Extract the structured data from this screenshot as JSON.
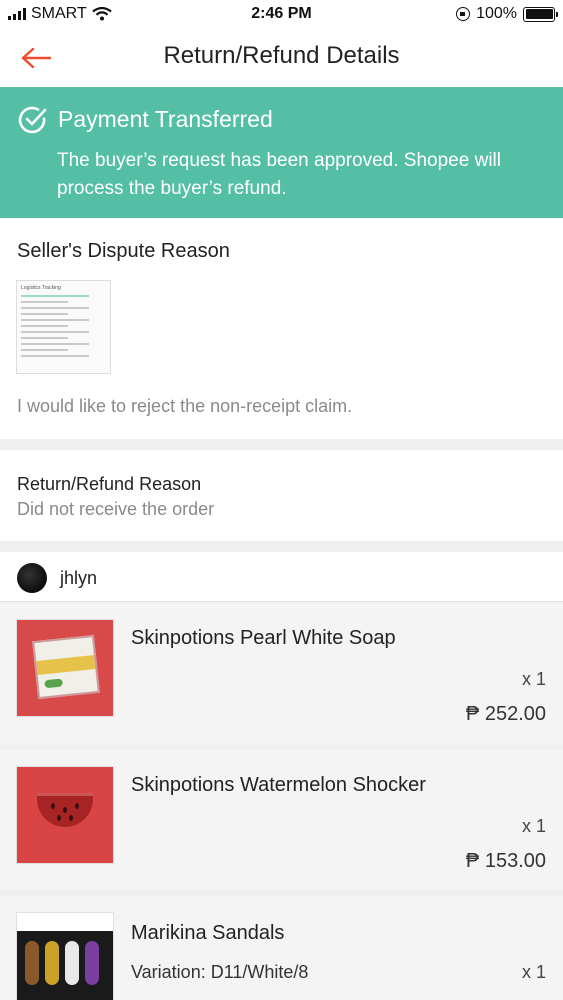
{
  "status_bar": {
    "carrier": "SMART",
    "time": "2:46 PM",
    "battery": "100%"
  },
  "header": {
    "title": "Return/Refund Details"
  },
  "banner": {
    "title": "Payment Transferred",
    "message": "The buyer’s request has been approved. Shopee will process the buyer’s refund.",
    "color": "#54bfa4"
  },
  "dispute": {
    "title": "Seller's Dispute Reason",
    "text": "I would like to reject the non-receipt claim.",
    "evidence_label": "Logistics Tracking"
  },
  "reason": {
    "title": "Return/Refund Reason",
    "value": "Did not receive the order"
  },
  "shop": {
    "name": "jhlyn"
  },
  "products": [
    {
      "name": "Skinpotions Pearl White Soap",
      "qty": "x 1",
      "price": "₱ 252.00"
    },
    {
      "name": "Skinpotions Watermelon Shocker",
      "qty": "x 1",
      "price": "₱ 153.00"
    },
    {
      "name": "Marikina Sandals",
      "variation": "Variation: D11/White/8",
      "qty": "x 1"
    }
  ],
  "accent_color": "#ee4d2d"
}
